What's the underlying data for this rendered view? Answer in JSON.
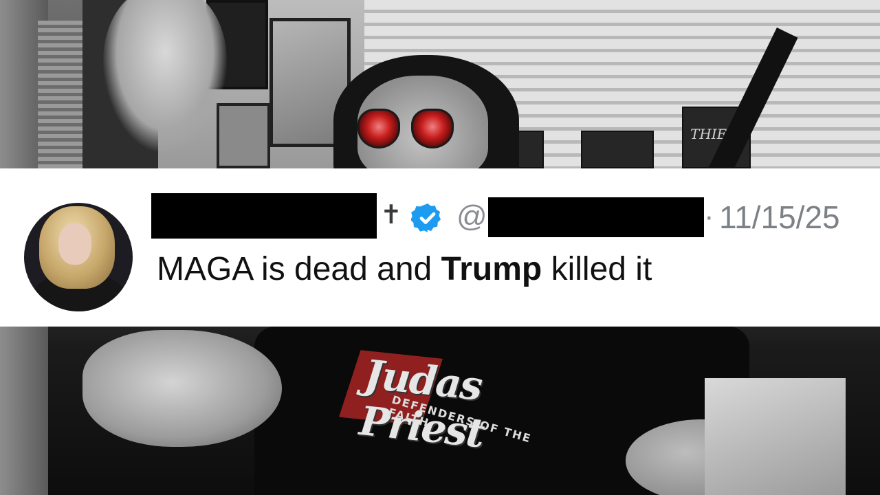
{
  "background": {
    "shirt_band": "Judas Priest",
    "shirt_tagline": "DEFENDERS OF THE FAITH",
    "shelf_game_title": "THIEF//"
  },
  "tweet": {
    "display_name": "",
    "handle_prefix": "@",
    "handle": "",
    "separator": "·",
    "date": "11/15/25",
    "text_part1": "MAGA is dead and ",
    "text_bold": "Trump",
    "text_part2": " killed it",
    "verified_color": "#1d9bf0",
    "icons": [
      "cross-icon",
      "verified-badge-icon"
    ]
  }
}
